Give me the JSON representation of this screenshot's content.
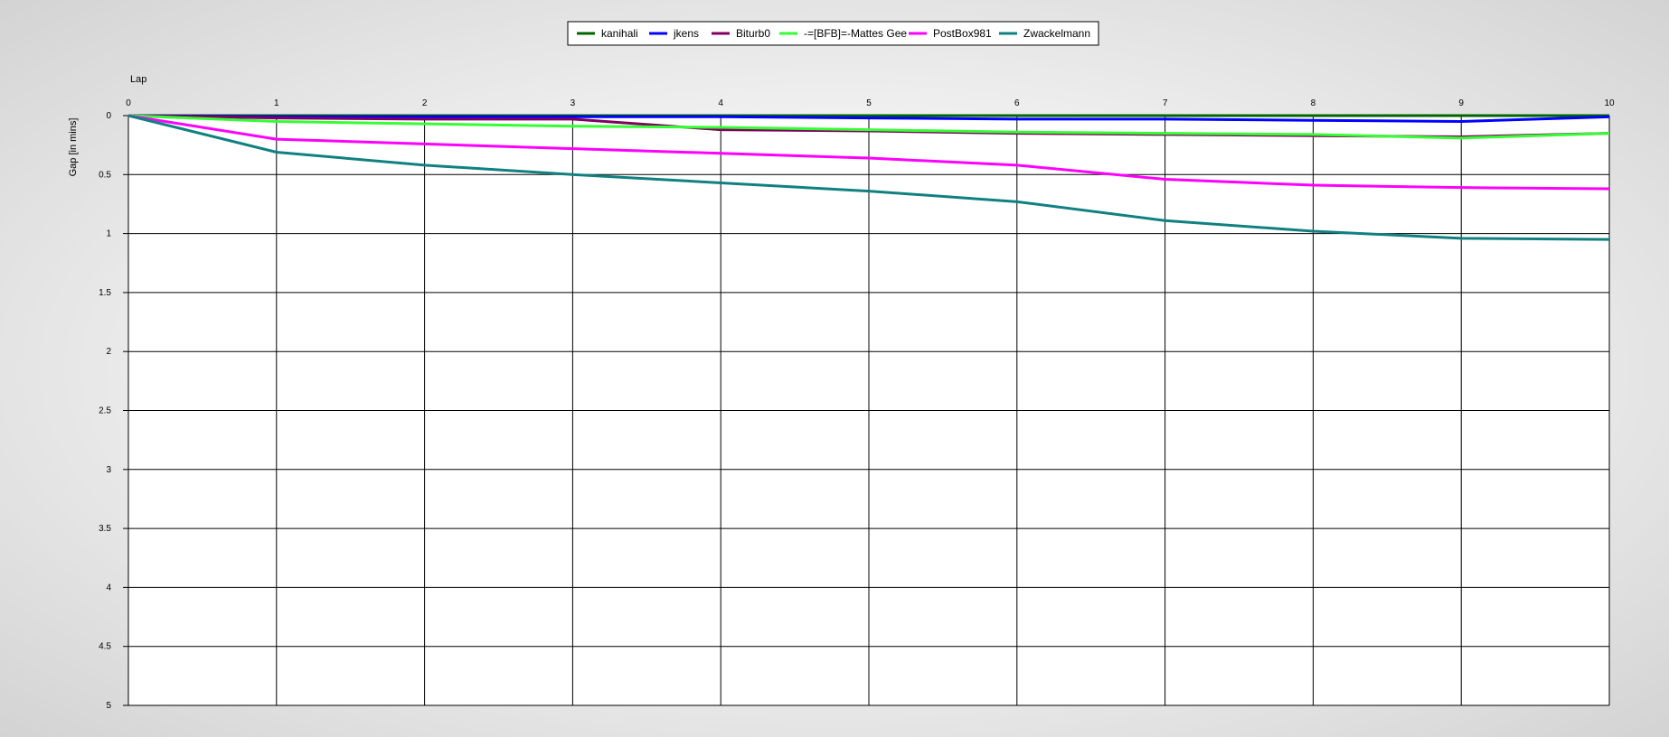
{
  "chart_data": {
    "type": "line",
    "xlabel": "Lap",
    "ylabel": "Gap [in mins]",
    "xlim": [
      0,
      10
    ],
    "ylim": [
      0,
      5
    ],
    "y_inverted": true,
    "grid": true,
    "legend_position": "top-center",
    "x_ticks": [
      "0",
      "1",
      "2",
      "3",
      "4",
      "5",
      "6",
      "7",
      "8",
      "9",
      "10"
    ],
    "y_ticks": [
      "0",
      "0.5",
      "1",
      "1.5",
      "2",
      "2.5",
      "3",
      "3.5",
      "4",
      "4.5",
      "5"
    ],
    "x": [
      0,
      1,
      2,
      3,
      4,
      5,
      6,
      7,
      8,
      9,
      10
    ],
    "series": [
      {
        "name": "kanihali",
        "color": "#006400",
        "values": [
          0,
          0,
          0,
          0,
          0,
          0,
          0,
          0,
          0,
          0,
          0
        ]
      },
      {
        "name": "jkens",
        "color": "#0000ff",
        "values": [
          0,
          0.01,
          0.01,
          0.01,
          0.01,
          0.02,
          0.03,
          0.03,
          0.04,
          0.05,
          0.01
        ]
      },
      {
        "name": "Biturb0",
        "color": "#800060",
        "values": [
          0,
          0.02,
          0.03,
          0.03,
          0.12,
          0.13,
          0.15,
          0.16,
          0.17,
          0.18,
          0.15
        ]
      },
      {
        "name": "-=[BFB]=-Mattes Gee",
        "color": "#33ff33",
        "values": [
          0,
          0.05,
          0.07,
          0.09,
          0.1,
          0.12,
          0.14,
          0.15,
          0.16,
          0.19,
          0.15
        ]
      },
      {
        "name": "PostBox981",
        "color": "#ff00ff",
        "values": [
          0,
          0.2,
          0.24,
          0.28,
          0.32,
          0.36,
          0.42,
          0.54,
          0.59,
          0.61,
          0.62
        ]
      },
      {
        "name": "Zwackelmann",
        "color": "#108080",
        "values": [
          0,
          0.31,
          0.42,
          0.5,
          0.57,
          0.64,
          0.73,
          0.89,
          0.98,
          1.04,
          1.05
        ]
      }
    ]
  }
}
